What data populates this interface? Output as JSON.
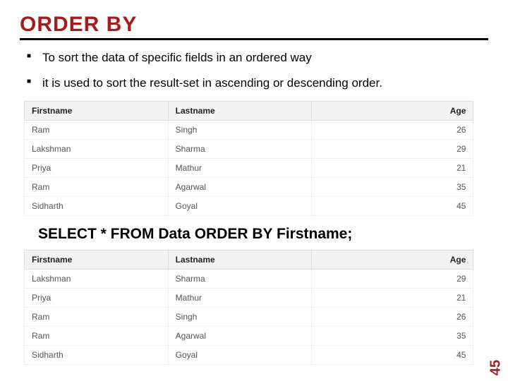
{
  "title": "ORDER BY",
  "bullets": [
    "To sort the data of specific fields in an ordered way",
    "it is used to sort the result-set in ascending or descending order."
  ],
  "table_headers": {
    "c0": "Firstname",
    "c1": "Lastname",
    "c2": "Age"
  },
  "table1": {
    "rows": [
      {
        "fn": "Ram",
        "ln": "Singh",
        "age": "26"
      },
      {
        "fn": "Lakshman",
        "ln": "Sharma",
        "age": "29"
      },
      {
        "fn": "Priya",
        "ln": "Mathur",
        "age": "21"
      },
      {
        "fn": "Ram",
        "ln": "Agarwal",
        "age": "35"
      },
      {
        "fn": "Sidharth",
        "ln": "Goyal",
        "age": "45"
      }
    ]
  },
  "query": "SELECT * FROM Data ORDER BY Firstname;",
  "table2": {
    "rows": [
      {
        "fn": "Lakshman",
        "ln": "Sharma",
        "age": "29"
      },
      {
        "fn": "Priya",
        "ln": "Mathur",
        "age": "21"
      },
      {
        "fn": "Ram",
        "ln": "Singh",
        "age": "26"
      },
      {
        "fn": "Ram",
        "ln": "Agarwal",
        "age": "35"
      },
      {
        "fn": "Sidharth",
        "ln": "Goyal",
        "age": "45"
      }
    ]
  },
  "page_number": "45",
  "colors": {
    "accent": "#a61c1c"
  }
}
